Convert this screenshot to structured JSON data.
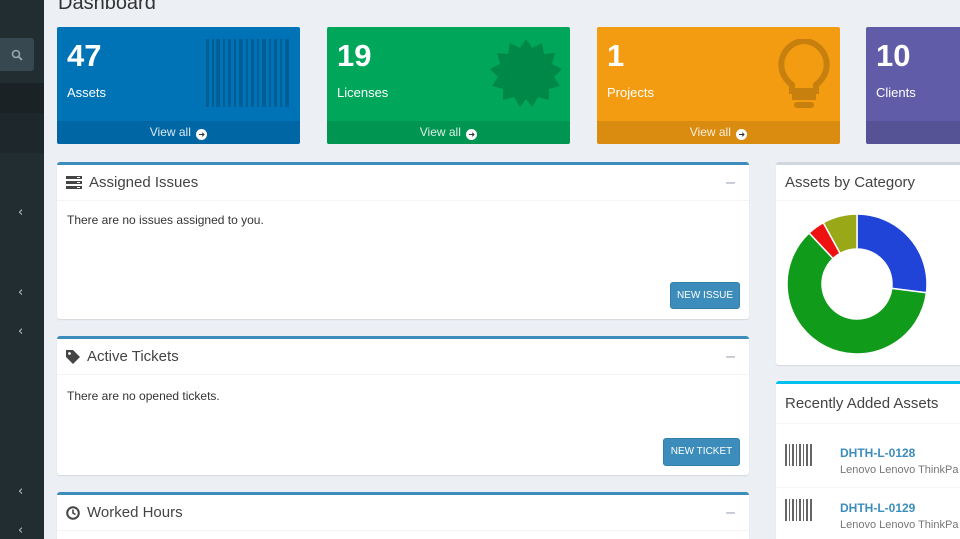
{
  "page": {
    "title": "Dashboard"
  },
  "sidebar": {
    "search_icon": "search-icon",
    "chevron": "‹"
  },
  "boxes": [
    {
      "value": "47",
      "label": "Assets",
      "link": "View all",
      "color": "#0073b7",
      "icon": "barcode-icon"
    },
    {
      "value": "19",
      "label": "Licenses",
      "link": "View all",
      "color": "#00a65a",
      "icon": "certificate-icon"
    },
    {
      "value": "1",
      "label": "Projects",
      "link": "View all",
      "color": "#f39c12",
      "icon": "lightbulb-icon"
    },
    {
      "value": "10",
      "label": "Clients",
      "link": "",
      "color": "#605ca8",
      "icon": "users-icon"
    }
  ],
  "assigned_issues": {
    "title": "Assigned Issues",
    "empty_text": "There are no issues assigned to you.",
    "button": "NEW ISSUE",
    "collapse": "–"
  },
  "active_tickets": {
    "title": "Active Tickets",
    "empty_text": "There are no opened tickets.",
    "button": "NEW TICKET",
    "collapse": "–"
  },
  "worked_hours": {
    "title": "Worked Hours",
    "collapse": "–"
  },
  "assets_by_category": {
    "title": "Assets by Category",
    "chart_data": {
      "type": "pie",
      "donut": true,
      "slices": [
        {
          "value": 27,
          "color": "#2043d8"
        },
        {
          "value": 61,
          "color": "#119b1b"
        },
        {
          "value": 4,
          "color": "#ee1111"
        },
        {
          "value": 8,
          "color": "#98a817"
        }
      ]
    }
  },
  "recent_assets": {
    "title": "Recently Added Assets",
    "items": [
      {
        "tag": "DHTH-L-0128",
        "desc": "Lenovo Lenovo ThinkPa"
      },
      {
        "tag": "DHTH-L-0129",
        "desc": "Lenovo Lenovo ThinkPa"
      }
    ]
  }
}
